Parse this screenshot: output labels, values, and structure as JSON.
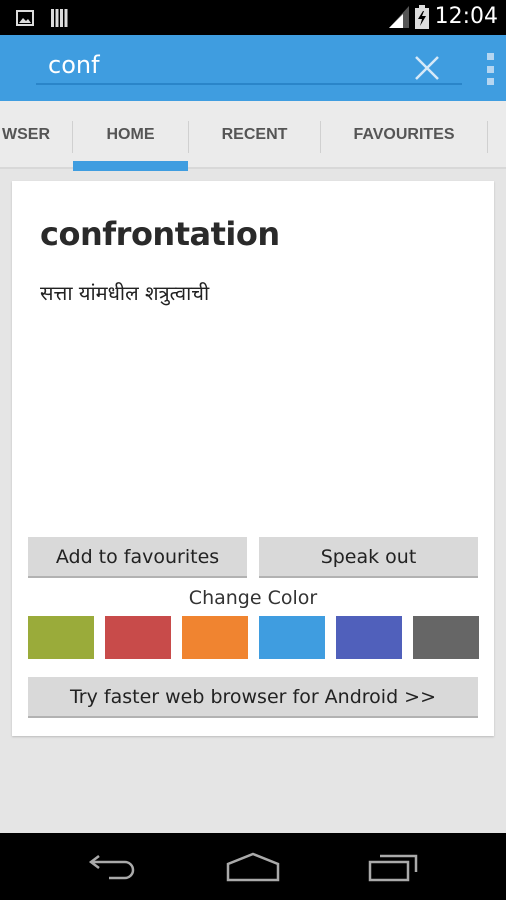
{
  "status_bar": {
    "time": "12:04",
    "icons": [
      "image-notification-icon",
      "barcode-notification-icon",
      "signal-icon",
      "battery-charging-icon"
    ]
  },
  "search": {
    "value": "conf",
    "placeholder": ""
  },
  "tabs": [
    {
      "label": "WSER",
      "full_label": "BROWSER",
      "active": false
    },
    {
      "label": "HOME",
      "active": true
    },
    {
      "label": "RECENT",
      "active": false
    },
    {
      "label": "FAVOURITES",
      "active": false
    }
  ],
  "entry": {
    "word": "confrontation",
    "meaning": "सत्ता यांमधील शत्रुत्वाची"
  },
  "buttons": {
    "add_favourites": "Add to favourites",
    "speak_out": "Speak out",
    "try_browser": "Try faster web browser for Android >>"
  },
  "change_color": {
    "label": "Change Color",
    "swatches": [
      {
        "name": "green",
        "color": "#9aab3a"
      },
      {
        "name": "red",
        "color": "#c84b4a"
      },
      {
        "name": "orange",
        "color": "#f08430"
      },
      {
        "name": "blue",
        "color": "#3f9de0"
      },
      {
        "name": "indigo",
        "color": "#5060bb"
      },
      {
        "name": "gray",
        "color": "#666666"
      }
    ]
  },
  "colors": {
    "accent": "#3f9de0",
    "action_bar": "#3f9de0"
  }
}
